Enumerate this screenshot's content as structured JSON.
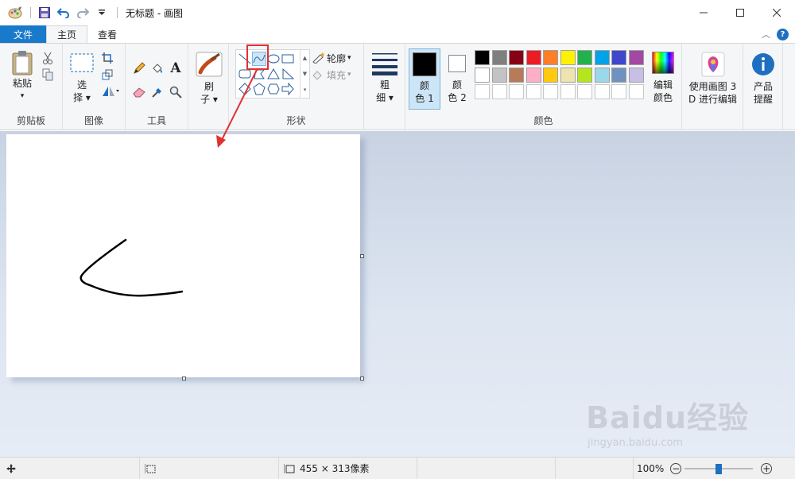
{
  "window": {
    "title": "无标题 - 画图",
    "minimize_icon": "minimize-icon",
    "maximize_icon": "maximize-icon",
    "close_icon": "close-icon"
  },
  "quick_access": {
    "items": [
      "paint-app-icon",
      "save-icon",
      "undo-icon",
      "redo-icon",
      "customize-dropdown-icon"
    ]
  },
  "tabs": {
    "file": "文件",
    "home": "主页",
    "view": "查看"
  },
  "ribbon": {
    "clipboard": {
      "label": "剪贴板",
      "paste_line1": "粘贴",
      "paste_arrow": "▾"
    },
    "image": {
      "label": "图像",
      "select_line1": "选",
      "select_line2": "择 ▾"
    },
    "tools": {
      "label": "工具"
    },
    "brushes": {
      "line1": "刷",
      "line2": "子 ▾"
    },
    "shapes": {
      "label": "形状",
      "outline": "轮廓",
      "fill": "填充",
      "dropdown": "▾"
    },
    "size": {
      "line1": "粗",
      "line2": "细 ▾"
    },
    "colors": {
      "label": "颜色",
      "color1_line1": "颜",
      "color1_line2": "色 1",
      "color2_line1": "颜",
      "color2_line2": "色 2",
      "edit_line1": "编辑",
      "edit_line2": "颜色",
      "row1": [
        "#000000",
        "#7f7f7f",
        "#880015",
        "#ed1c24",
        "#ff7f27",
        "#fff200",
        "#22b14c",
        "#00a2e8",
        "#3f48cc",
        "#a349a4"
      ],
      "row2": [
        "#ffffff",
        "#c3c3c3",
        "#b97a57",
        "#ffaec9",
        "#ffc90e",
        "#efe4b0",
        "#b5e61d",
        "#99d9ea",
        "#7092be",
        "#c8bfe7"
      ],
      "row3": [
        "#ffffff",
        "#ffffff",
        "#ffffff",
        "#ffffff",
        "#ffffff",
        "#ffffff",
        "#ffffff",
        "#ffffff",
        "#ffffff",
        "#ffffff"
      ],
      "color1": "#000000",
      "color2": "#ffffff"
    },
    "paint3d": {
      "line1": "使用画图 3",
      "line2": "D 进行编辑"
    },
    "product": {
      "line1": "产品",
      "line2": "提醒"
    }
  },
  "canvas": {
    "stroke_color": "#000000"
  },
  "statusbar": {
    "image_size": "455 × 313像素",
    "zoom": "100%",
    "zoom_level": 0.5
  },
  "watermark": {
    "brand": "Baidu经验",
    "url": "jingyan.baidu.com"
  },
  "annotation": {
    "color": "#e13232"
  }
}
